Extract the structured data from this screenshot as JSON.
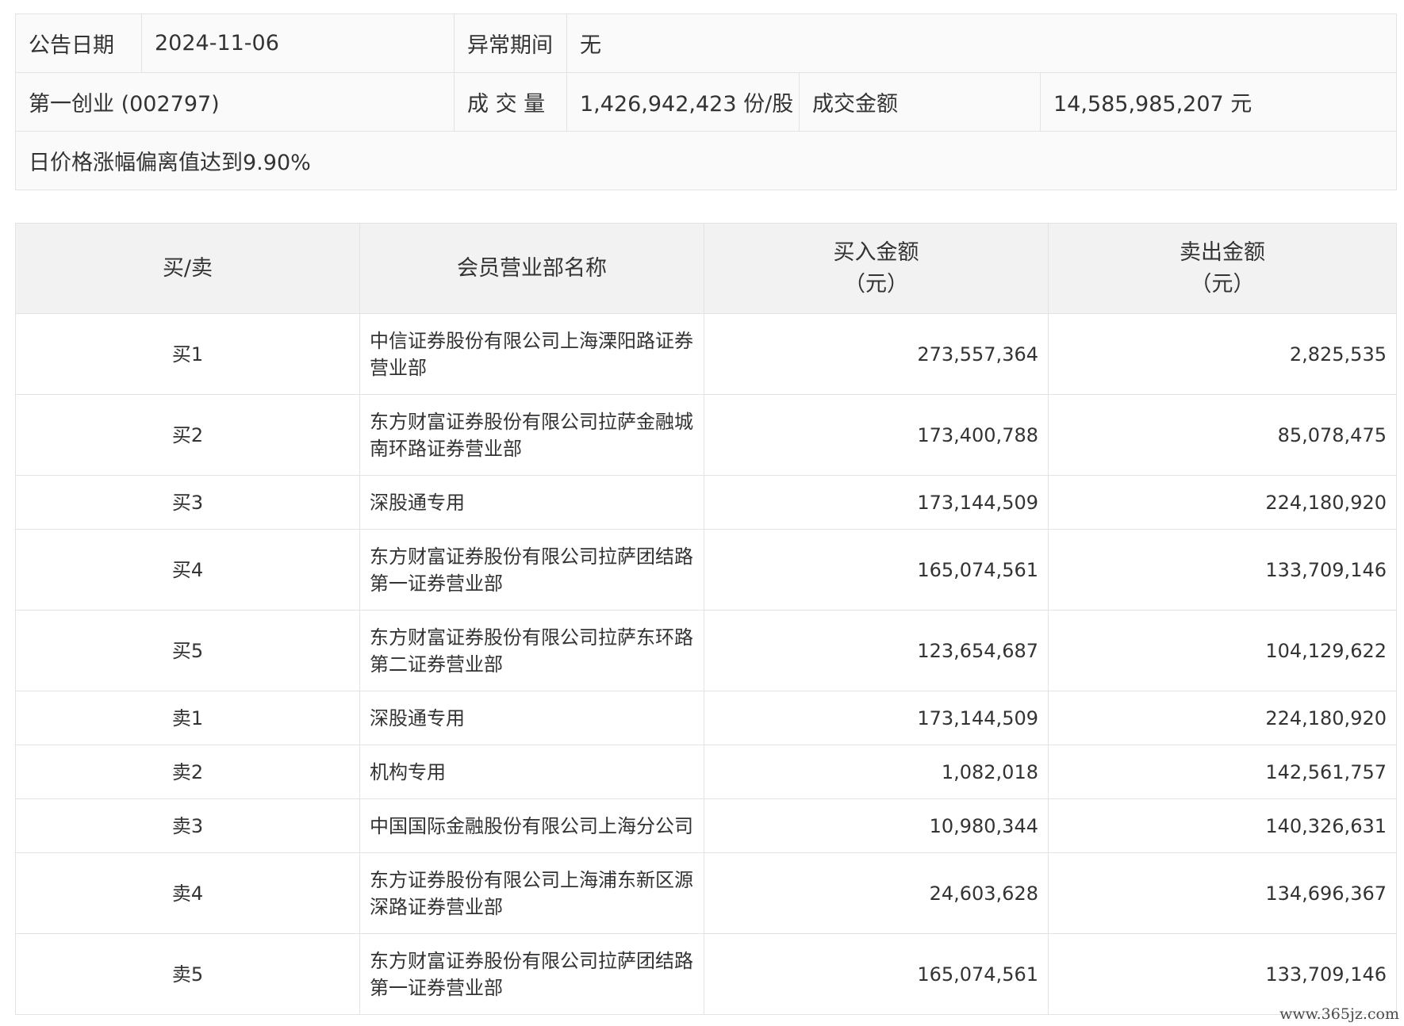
{
  "info": {
    "date_label": "公告日期",
    "date_value": "2024-11-06",
    "period_label": "异常期间",
    "period_value": "无",
    "stock_name": "第一创业 (002797)",
    "volume_label": "成 交 量",
    "volume_value": "1,426,942,423 份/股",
    "amount_label": "成交金额",
    "amount_value": "14,585,985,207 元",
    "reason": "日价格涨幅偏离值达到9.90%"
  },
  "table": {
    "headers": {
      "side": "买/卖",
      "name": "会员营业部名称",
      "buy_line1": "买入金额",
      "buy_line2": "（元）",
      "sell_line1": "卖出金额",
      "sell_line2": "（元）"
    },
    "rows": [
      {
        "side": "买1",
        "name": "中信证券股份有限公司上海溧阳路证券营业部",
        "buy": "273,557,364",
        "sell": "2,825,535"
      },
      {
        "side": "买2",
        "name": "东方财富证券股份有限公司拉萨金融城南环路证券营业部",
        "buy": "173,400,788",
        "sell": "85,078,475"
      },
      {
        "side": "买3",
        "name": "深股通专用",
        "buy": "173,144,509",
        "sell": "224,180,920"
      },
      {
        "side": "买4",
        "name": "东方财富证券股份有限公司拉萨团结路第一证券营业部",
        "buy": "165,074,561",
        "sell": "133,709,146"
      },
      {
        "side": "买5",
        "name": "东方财富证券股份有限公司拉萨东环路第二证券营业部",
        "buy": "123,654,687",
        "sell": "104,129,622"
      },
      {
        "side": "卖1",
        "name": "深股通专用",
        "buy": "173,144,509",
        "sell": "224,180,920"
      },
      {
        "side": "卖2",
        "name": "机构专用",
        "buy": "1,082,018",
        "sell": "142,561,757"
      },
      {
        "side": "卖3",
        "name": "中国国际金融股份有限公司上海分公司",
        "buy": "10,980,344",
        "sell": "140,326,631"
      },
      {
        "side": "卖4",
        "name": "东方证券股份有限公司上海浦东新区源深路证券营业部",
        "buy": "24,603,628",
        "sell": "134,696,367"
      },
      {
        "side": "卖5",
        "name": "东方财富证券股份有限公司拉萨团结路第一证券营业部",
        "buy": "165,074,561",
        "sell": "133,709,146"
      }
    ]
  },
  "watermark": "www.365jz.com"
}
